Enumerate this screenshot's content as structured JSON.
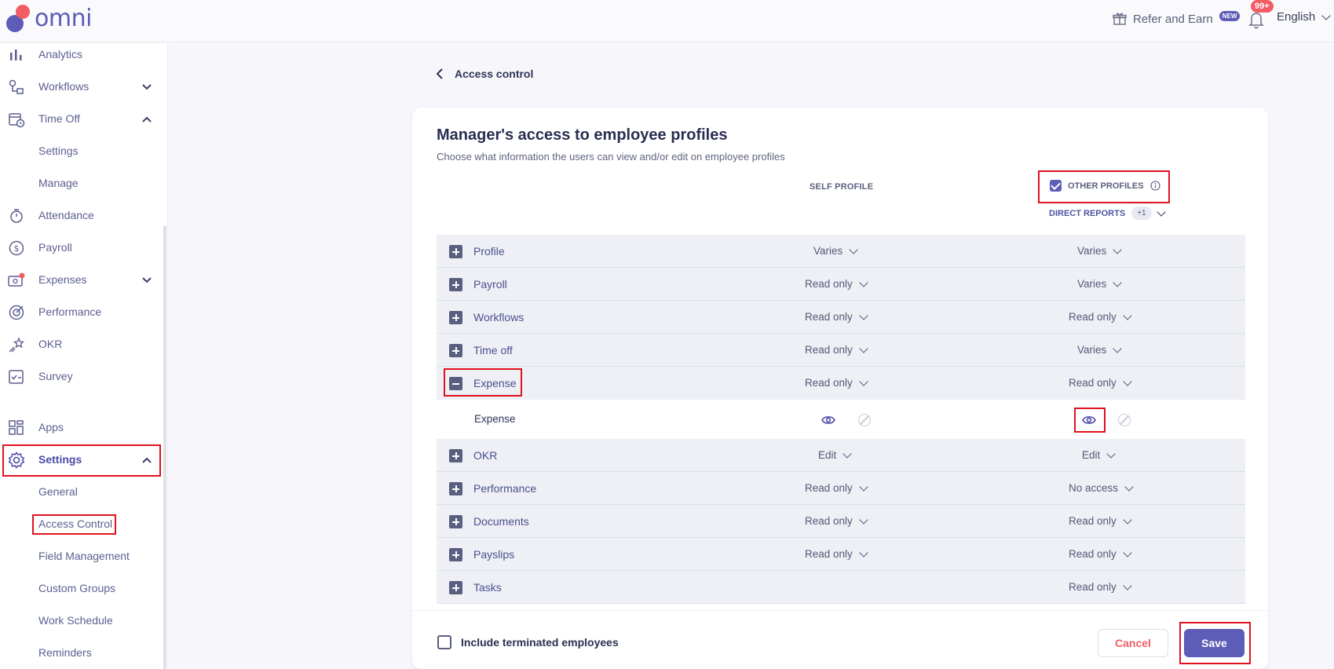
{
  "app": {
    "logo_text": "omni"
  },
  "topbar": {
    "refer_label": "Refer and Earn",
    "new_badge": "NEW",
    "notification_count": "99+",
    "language": "English"
  },
  "sidebar": {
    "items": [
      {
        "label": "Analytics",
        "icon": "bar-chart-icon"
      },
      {
        "label": "Workflows",
        "icon": "workflow-icon"
      },
      {
        "label": "Time Off",
        "icon": "calendar-clock-icon"
      },
      {
        "label": "Attendance",
        "icon": "stopwatch-icon"
      },
      {
        "label": "Payroll",
        "icon": "dollar-circle-icon"
      },
      {
        "label": "Expenses",
        "icon": "wallet-icon"
      },
      {
        "label": "Performance",
        "icon": "target-icon"
      },
      {
        "label": "OKR",
        "icon": "star-icon"
      },
      {
        "label": "Survey",
        "icon": "checklist-icon"
      },
      {
        "label": "Apps",
        "icon": "grid-icon"
      },
      {
        "label": "Settings",
        "icon": "gear-icon"
      }
    ],
    "timeoff_sub": [
      "Settings",
      "Manage"
    ],
    "settings_sub": [
      "General",
      "Access Control",
      "Field Management",
      "Custom Groups",
      "Work Schedule",
      "Reminders"
    ]
  },
  "breadcrumb": {
    "label": "Access control"
  },
  "card": {
    "title": "Manager's access to employee profiles",
    "subtitle": "Choose what information the users can view and/or edit on employee profiles",
    "self_profile_header": "SELF PROFILE",
    "other_profiles_header": "OTHER PROFILES",
    "direct_reports_label": "DIRECT REPORTS",
    "direct_reports_extra": "+1",
    "rows": [
      {
        "name": "Profile",
        "self": "Varies",
        "other": "Varies"
      },
      {
        "name": "Payroll",
        "self": "Read only",
        "other": "Varies"
      },
      {
        "name": "Workflows",
        "self": "Read only",
        "other": "Read only"
      },
      {
        "name": "Time off",
        "self": "Read only",
        "other": "Varies"
      },
      {
        "name": "Expense",
        "self": "Read only",
        "other": "Read only"
      },
      {
        "name": "OKR",
        "self": "Edit",
        "other": "Edit"
      },
      {
        "name": "Performance",
        "self": "Read only",
        "other": "No access"
      },
      {
        "name": "Documents",
        "self": "Read only",
        "other": "Read only"
      },
      {
        "name": "Payslips",
        "self": "Read only",
        "other": "Read only"
      },
      {
        "name": "Tasks",
        "self": "",
        "other": "Read only"
      }
    ],
    "expense_sub_row": {
      "name": "Expense"
    },
    "footer": {
      "include_terminated": "Include terminated employees",
      "cancel": "Cancel",
      "save": "Save"
    }
  },
  "colors": {
    "accent": "#5d5cb6",
    "danger": "#f15d62",
    "highlight": "#e0121f"
  }
}
